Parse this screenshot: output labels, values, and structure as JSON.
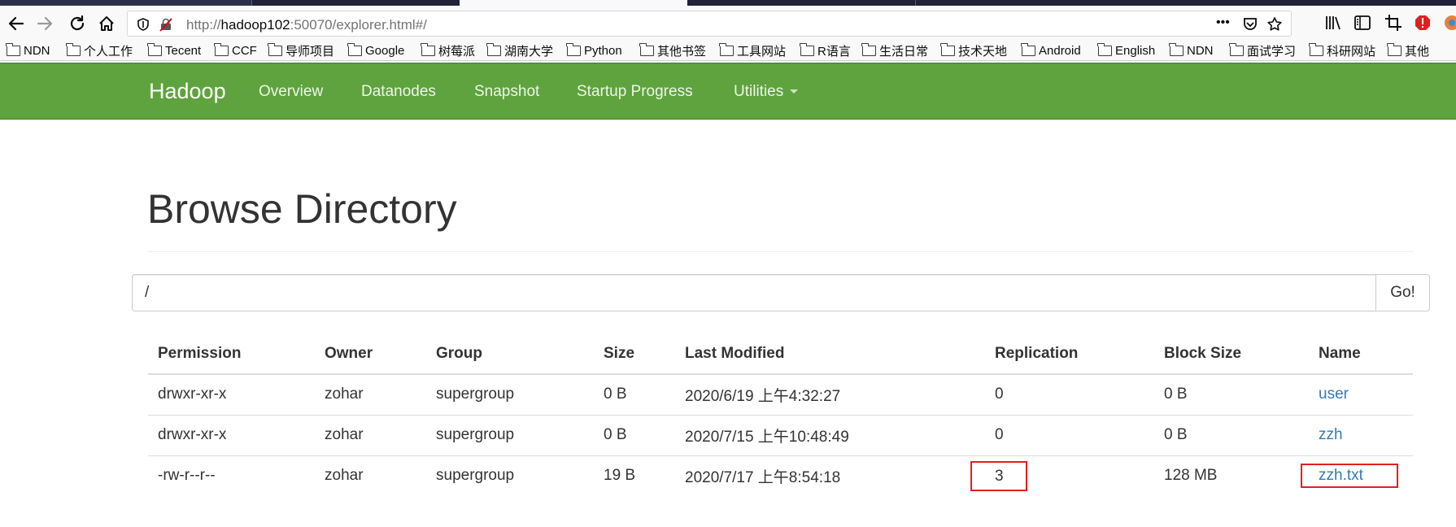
{
  "browser": {
    "url_prefix": "http://",
    "url_host": "hadoop102",
    "url_rest": ":50070/explorer.html#/",
    "more_label": "•••",
    "bookmarks": [
      "NDN",
      "个人工作",
      "Tecent",
      "CCF",
      "导师项目",
      "Google",
      "树莓派",
      "湖南大学",
      "Python",
      "其他书签",
      "工具网站",
      "R语言",
      "生活日常",
      "技术天地",
      "Android",
      "English",
      "NDN",
      "面试学习",
      "科研网站",
      "其他"
    ]
  },
  "hadoop_nav": {
    "brand": "Hadoop",
    "links": [
      "Overview",
      "Datanodes",
      "Snapshot",
      "Startup Progress",
      "Utilities"
    ]
  },
  "page": {
    "title": "Browse Directory",
    "path_value": "/",
    "go_label": "Go!"
  },
  "table": {
    "headers": [
      "Permission",
      "Owner",
      "Group",
      "Size",
      "Last Modified",
      "Replication",
      "Block Size",
      "Name"
    ],
    "rows": [
      [
        "drwxr-xr-x",
        "zohar",
        "supergroup",
        "0 B",
        "2020/6/19 上午4:32:27",
        "0",
        "0 B",
        "user"
      ],
      [
        "drwxr-xr-x",
        "zohar",
        "supergroup",
        "0 B",
        "2020/7/15 上午10:48:49",
        "0",
        "0 B",
        "zzh"
      ],
      [
        "-rw-r--r--",
        "zohar",
        "supergroup",
        "19 B",
        "2020/7/17 上午8:54:18",
        "3",
        "128 MB",
        "zzh.txt"
      ]
    ]
  },
  "colors": {
    "nav_green": "#5fa33e",
    "link_blue": "#337ab7",
    "highlight_red": "#e02020"
  },
  "icons": [
    "back-icon",
    "forward-icon",
    "reload-icon",
    "home-icon",
    "shield-icon",
    "insecure-lock-icon",
    "more-icon",
    "pocket-icon",
    "star-icon",
    "library-icon",
    "sidebar-icon",
    "crop-icon",
    "extension-icon",
    "folder-icon"
  ]
}
